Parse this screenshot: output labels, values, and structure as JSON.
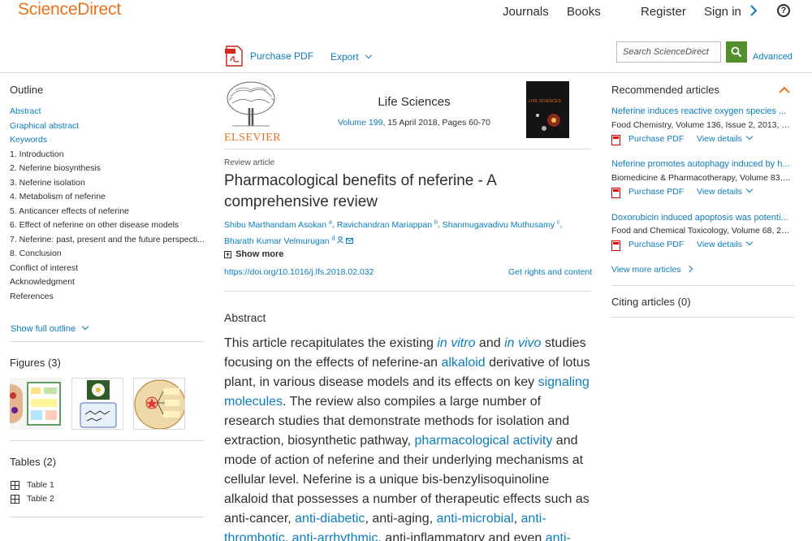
{
  "header": {
    "logo": "ScienceDirect",
    "nav": {
      "journals": "Journals",
      "books": "Books",
      "register": "Register",
      "sign_in": "Sign in"
    },
    "help": "?"
  },
  "toolbar": {
    "purchase_pdf": "Purchase PDF",
    "export": "Export",
    "search_placeholder": "Search ScienceDirect",
    "advanced": "Advanced"
  },
  "outline": {
    "title": "Outline",
    "items": [
      "Abstract",
      "Graphical abstract",
      "Keywords",
      "1. Introduction",
      "2. Neferine biosynthesis",
      "3. Neferine isolation",
      "4. Metabolism of neferine",
      "5. Anticancer effects of neferine",
      "6. Effect of neferine on other disease models",
      "7. Neferine: past, present and the future perspecti...",
      "8. Conclusion",
      "Conflict of interest",
      "Acknowledgment",
      "References"
    ],
    "show_full": "Show full outline"
  },
  "figures": {
    "title": "Figures (3)"
  },
  "tables": {
    "title": "Tables (2)",
    "items": [
      "Table 1",
      "Table 2"
    ]
  },
  "article": {
    "publisher": "ELSEVIER",
    "journal": "Life Sciences",
    "cover_text": "LIFE SCIENCES",
    "volume_link": "Volume 199",
    "issue_rest": ", 15 April 2018, Pages 60-70",
    "type": "Review article",
    "title": "Pharmacological benefits of neferine - A comprehensive review",
    "authors": [
      {
        "name": "Shibu Marthandam Asokan",
        "sup": "a"
      },
      {
        "name": "Ravichandran Mariappan",
        "sup": "b"
      },
      {
        "name": "Shanmugavadivu Muthusamy",
        "sup": "c"
      },
      {
        "name": "Bharath Kumar Velmurugan",
        "sup": "d"
      }
    ],
    "show_more": "Show more",
    "doi": "https://doi.org/10.1016/j.lfs.2018.02.032",
    "rights": "Get rights and content",
    "abstract_heading": "Abstract",
    "abstract": {
      "t1": "This article recapitulates the existing ",
      "l1": "in vitro",
      "t2": " and ",
      "l2": "in vivo",
      "t3": " studies focusing on the effects of neferine-an ",
      "l3": "alkaloid",
      "t4": " derivative of lotus plant, in various disease models and its effects on key ",
      "l4": "signaling molecules",
      "t5": ". The review also compiles a large number of research studies that demonstrate methods for isolation and extraction, biosynthetic pathway, ",
      "l5": "pharmacological activity",
      "t6": " and mode of action of neferine and their underlying mechanisms at cellular level. Neferine is a unique bis-benzylisoquinoline alkaloid that possesses a number of therapeutic effects such as anti-cancer, ",
      "l6": "anti-diabetic",
      "t7": ", anti-aging, ",
      "l7": "anti-microbial",
      "t8": ", ",
      "l8": "anti-thrombotic",
      "t9": ", ",
      "l9": "anti-arrhythmic",
      "t10": ", anti-inflammatory and even ",
      "l10": "anti-"
    }
  },
  "recommended": {
    "title": "Recommended articles",
    "items": [
      {
        "title": "Neferine induces reactive oxygen species ...",
        "source": "Food Chemistry, Volume 136, Issue 2, 2013, p..."
      },
      {
        "title": "Neferine promotes autophagy induced by h...",
        "source": "Biomedicine & Pharmacotherapy, Volume 83, ..."
      },
      {
        "title": "Doxorubicin induced apoptosis was potenti...",
        "source": "Food and Chemical Toxicology, Volume 68, 20..."
      }
    ],
    "purchase_pdf": "Purchase PDF",
    "view_details": "View details",
    "view_more": "View more articles"
  },
  "citing": {
    "title": "Citing articles (0)"
  },
  "colors": {
    "brand_orange": "#e9711c",
    "link_blue": "#0c7dbb",
    "search_green": "#538f2f"
  }
}
